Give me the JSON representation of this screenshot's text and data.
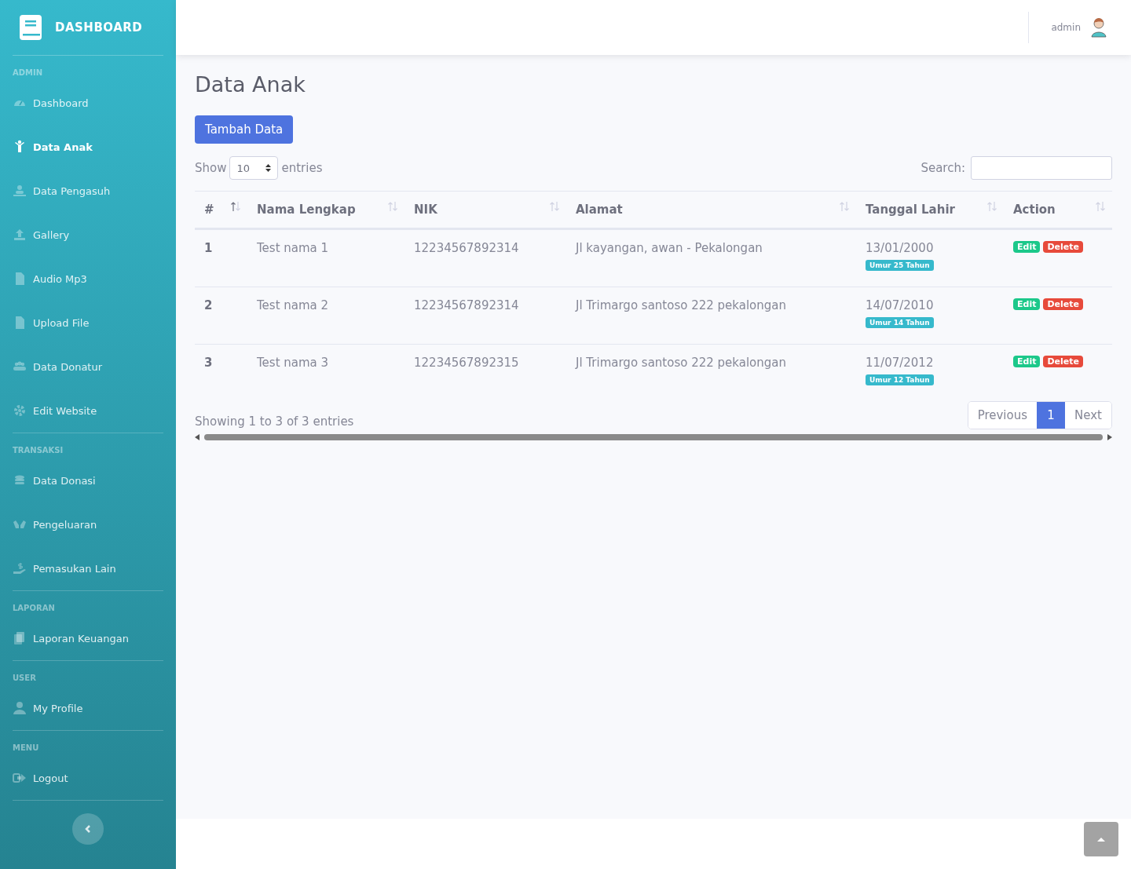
{
  "sidebar": {
    "brand": "DASHBOARD",
    "sections": [
      {
        "heading": "ADMIN",
        "items": [
          {
            "label": "Dashboard",
            "selected": false
          },
          {
            "label": "Data Anak",
            "selected": true
          },
          {
            "label": "Data Pengasuh",
            "selected": false
          },
          {
            "label": "Gallery",
            "selected": false
          },
          {
            "label": "Audio Mp3",
            "selected": false
          },
          {
            "label": "Upload File",
            "selected": false
          },
          {
            "label": "Data Donatur",
            "selected": false
          },
          {
            "label": "Edit Website",
            "selected": false
          }
        ]
      },
      {
        "heading": "TRANSAKSI",
        "items": [
          {
            "label": "Data Donasi",
            "selected": false
          },
          {
            "label": "Pengeluaran",
            "selected": false
          },
          {
            "label": "Pemasukan Lain",
            "selected": false
          }
        ]
      },
      {
        "heading": "LAPORAN",
        "items": [
          {
            "label": "Laporan Keuangan",
            "selected": false
          }
        ]
      },
      {
        "heading": "USER",
        "items": [
          {
            "label": "My Profile",
            "selected": false
          }
        ]
      },
      {
        "heading": "MENU",
        "items": [
          {
            "label": "Logout",
            "selected": false
          }
        ]
      }
    ]
  },
  "topbar": {
    "user": "admin"
  },
  "page": {
    "title": "Data Anak",
    "add_button": "Tambah Data",
    "show_label": "Show",
    "entries_value": "10",
    "entries_label": "entries",
    "search_label": "Search:"
  },
  "table": {
    "columns": [
      {
        "label": "#",
        "sorted": true
      },
      {
        "label": "Nama Lengkap",
        "sorted": false
      },
      {
        "label": "NIK",
        "sorted": false
      },
      {
        "label": "Alamat",
        "sorted": false
      },
      {
        "label": "Tanggal Lahir",
        "sorted": false
      },
      {
        "label": "Action",
        "sorted": false
      }
    ],
    "rows": [
      {
        "no": "1",
        "name": "Test nama 1",
        "nik": "12234567892314",
        "address": "Jl kayangan, awan - Pekalongan",
        "birth_date": "13/01/2000",
        "age": "Umur 25 Tahun",
        "edit": "Edit",
        "delete": "Delete"
      },
      {
        "no": "2",
        "name": "Test nama 2",
        "nik": "12234567892314",
        "address": "Jl Trimargo santoso 222 pekalongan",
        "birth_date": "14/07/2010",
        "age": "Umur 14 Tahun",
        "edit": "Edit",
        "delete": "Delete"
      },
      {
        "no": "3",
        "name": "Test nama 3",
        "nik": "12234567892315",
        "address": "Jl Trimargo santoso 222 pekalongan",
        "birth_date": "11/07/2012",
        "age": "Umur 12 Tahun",
        "edit": "Edit",
        "delete": "Delete"
      }
    ]
  },
  "footer": {
    "info": "Showing 1 to 3 of 3 entries",
    "pagination": [
      {
        "label": "Previous",
        "selected": false
      },
      {
        "label": "1",
        "selected": true
      },
      {
        "label": "Next",
        "selected": false
      }
    ]
  }
}
